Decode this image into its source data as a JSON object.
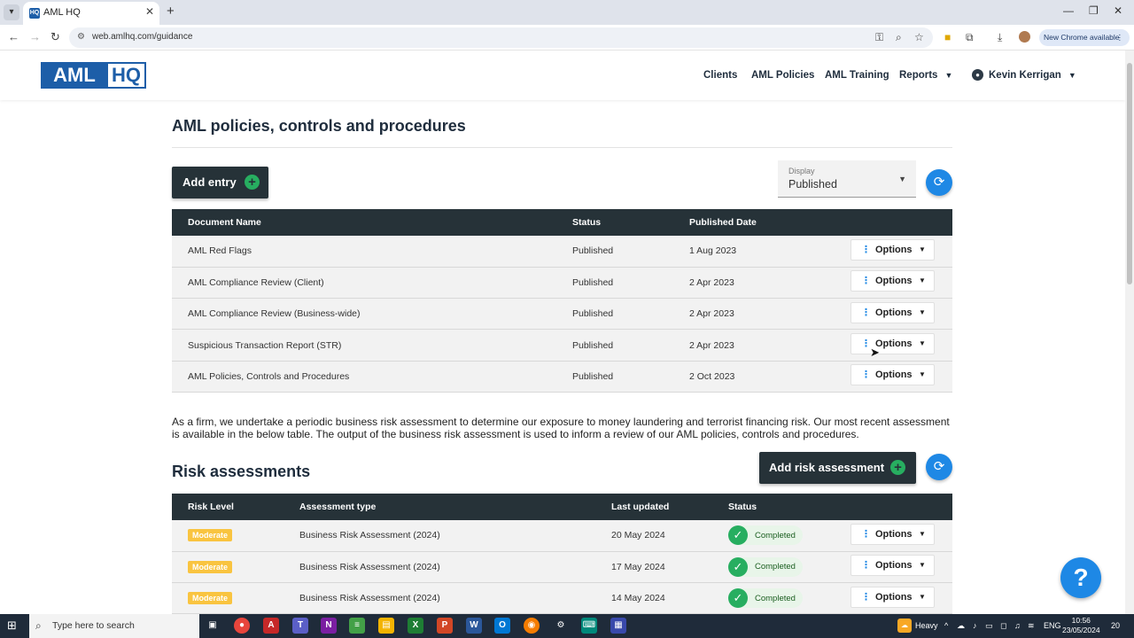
{
  "browser": {
    "tab_title": "AML HQ",
    "tab_favicon": "HQ",
    "url": "web.amlhq.com/guidance",
    "new_chrome_label": "New Chrome available"
  },
  "header": {
    "logo_left": "AML",
    "logo_right": "HQ",
    "nav": [
      "Clients",
      "AML Policies",
      "AML Training",
      "Reports"
    ],
    "user_name": "Kevin Kerrigan"
  },
  "policies": {
    "title": "AML policies, controls and procedures",
    "add_entry_label": "Add entry",
    "display_label": "Display",
    "display_value": "Published",
    "columns": [
      "Document Name",
      "Status",
      "Published Date"
    ],
    "rows": [
      {
        "name": "AML Red Flags",
        "status": "Published",
        "date": "1 Aug 2023"
      },
      {
        "name": "AML Compliance Review (Client)",
        "status": "Published",
        "date": "2 Apr 2023"
      },
      {
        "name": "AML Compliance Review (Business-wide)",
        "status": "Published",
        "date": "2 Apr 2023"
      },
      {
        "name": "Suspicious Transaction Report (STR)",
        "status": "Published",
        "date": "2 Apr 2023"
      },
      {
        "name": "AML Policies, Controls and Procedures",
        "status": "Published",
        "date": "2 Oct 2023"
      }
    ],
    "options_label": "Options"
  },
  "intro_paragraph": "As a firm, we undertake a periodic business risk assessment to determine our exposure to money laundering and terrorist financing risk. Our most recent assessment is available in the below table. The output of the business risk assessment is used to inform a review of our AML policies, controls and procedures.",
  "risk": {
    "title": "Risk assessments",
    "add_label": "Add risk assessment",
    "columns": [
      "Risk Level",
      "Assessment type",
      "Last updated",
      "Status"
    ],
    "rows": [
      {
        "level": "Moderate",
        "type": "Business Risk Assessment (2024)",
        "updated": "20 May 2024",
        "status": "Completed"
      },
      {
        "level": "Moderate",
        "type": "Business Risk Assessment (2024)",
        "updated": "17 May 2024",
        "status": "Completed"
      },
      {
        "level": "Moderate",
        "type": "Business Risk Assessment (2024)",
        "updated": "14 May 2024",
        "status": "Completed"
      }
    ],
    "options_label": "Options"
  },
  "help_label": "?",
  "taskbar": {
    "search_placeholder": "Type here to search",
    "weather": "Heavy",
    "lang": "ENG",
    "time": "10:56",
    "date": "23/05/2024",
    "notifications": "20"
  },
  "colors": {
    "brand": "#1d5ea8",
    "dark": "#263238",
    "accent": "#1e88e5",
    "success": "#27ae60",
    "moderate": "#f9c440"
  }
}
